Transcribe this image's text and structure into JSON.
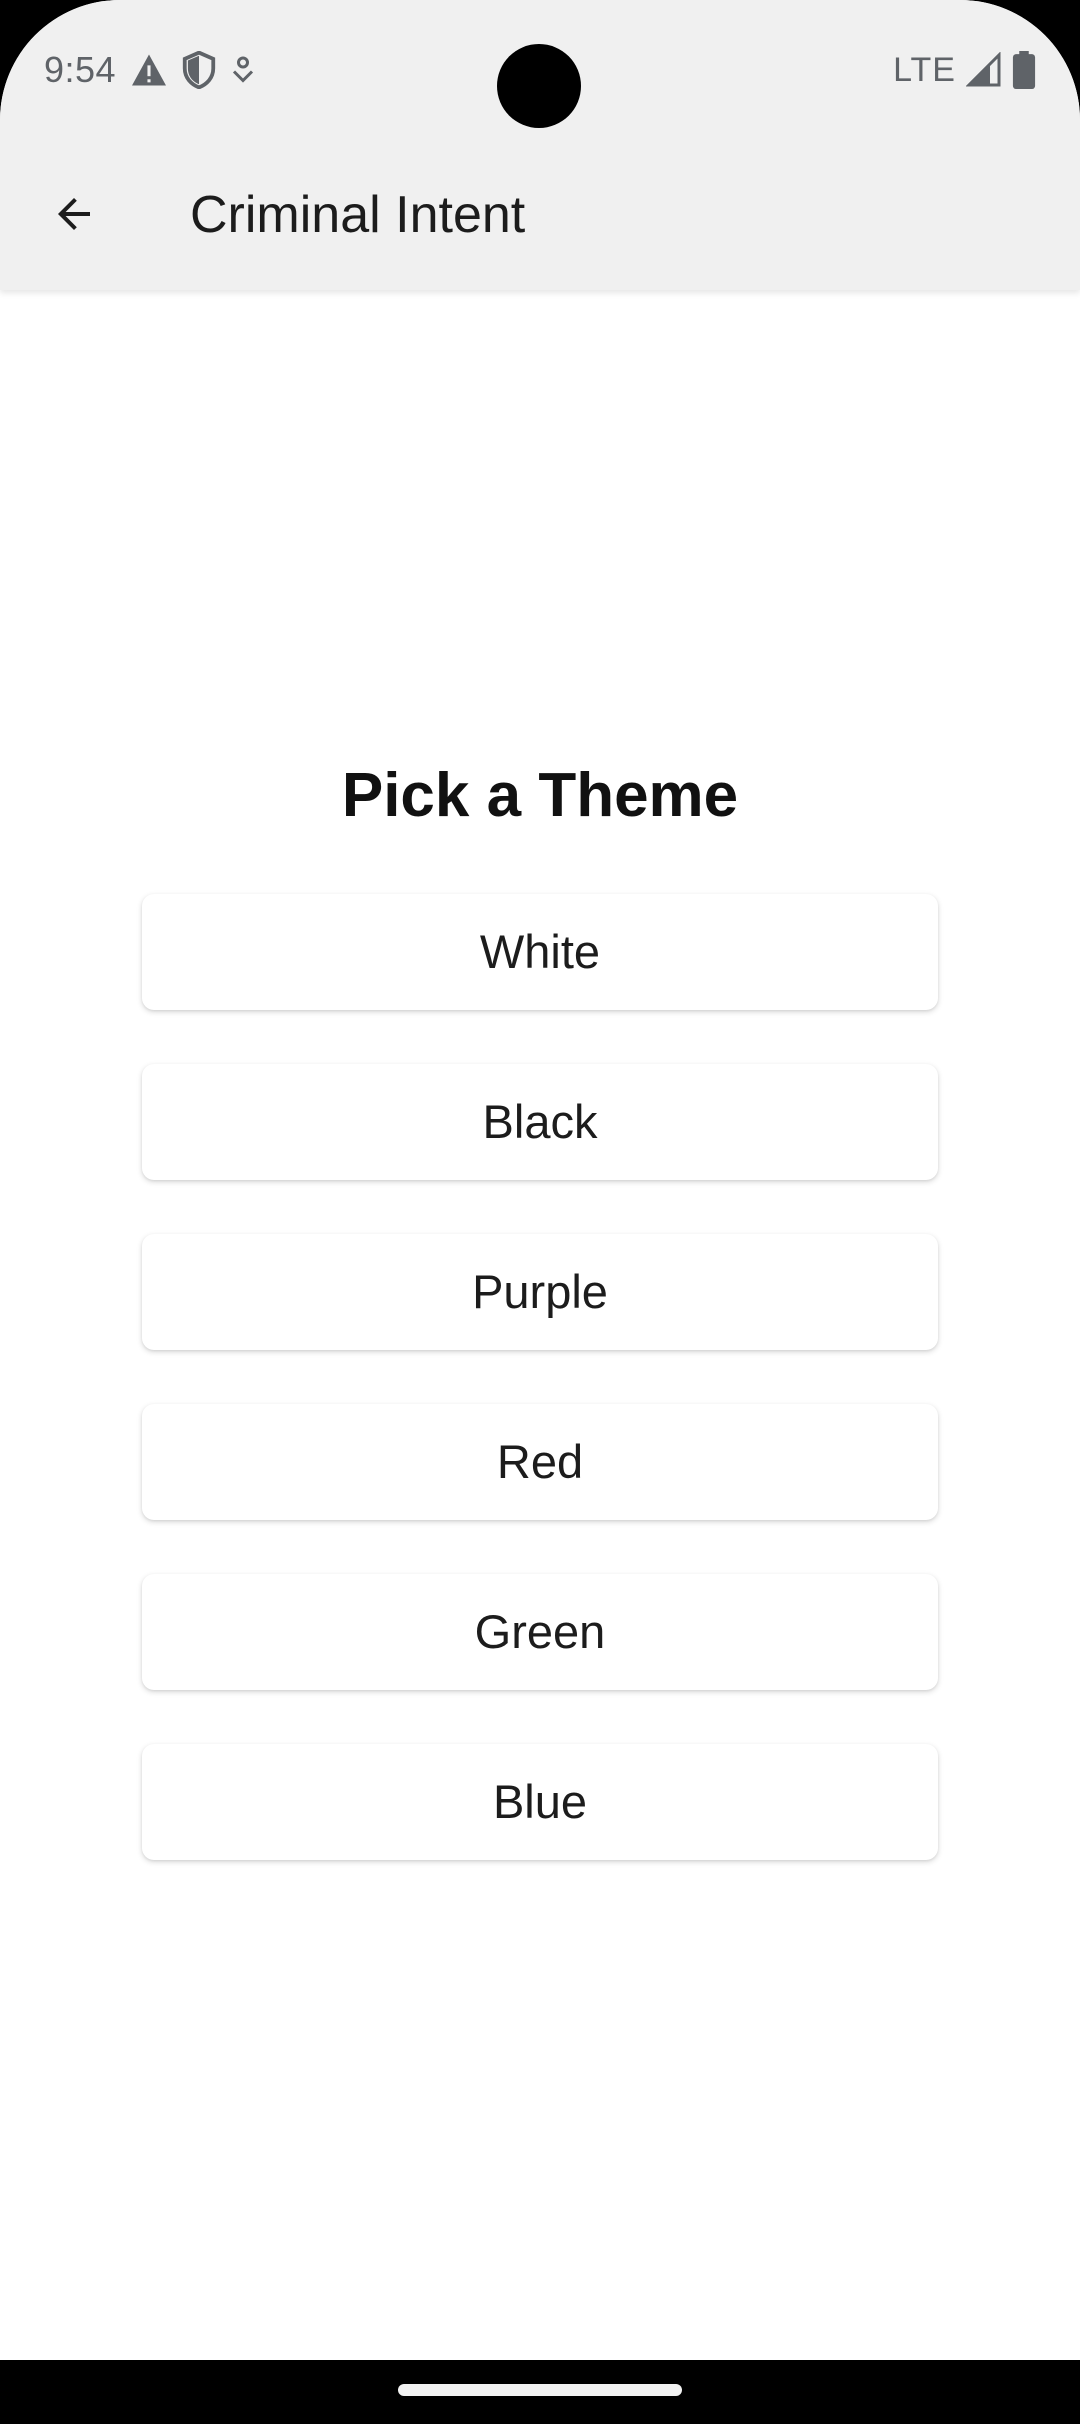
{
  "status_bar": {
    "time": "9:54",
    "network": "LTE",
    "icons": [
      "warning-icon",
      "shield-icon",
      "location-icon",
      "signal-icon",
      "battery-icon"
    ]
  },
  "toolbar": {
    "back_icon": "arrow-back-icon",
    "title": "Criminal Intent"
  },
  "main": {
    "heading": "Pick a Theme",
    "themes": [
      {
        "label": "White"
      },
      {
        "label": "Black"
      },
      {
        "label": "Purple"
      },
      {
        "label": "Red"
      },
      {
        "label": "Green"
      },
      {
        "label": "Blue"
      }
    ]
  },
  "colors": {
    "toolbar_background": "#f0f0f0",
    "page_background": "#ffffff",
    "text_primary": "#1c1c1c",
    "status_text": "#5f6368"
  }
}
